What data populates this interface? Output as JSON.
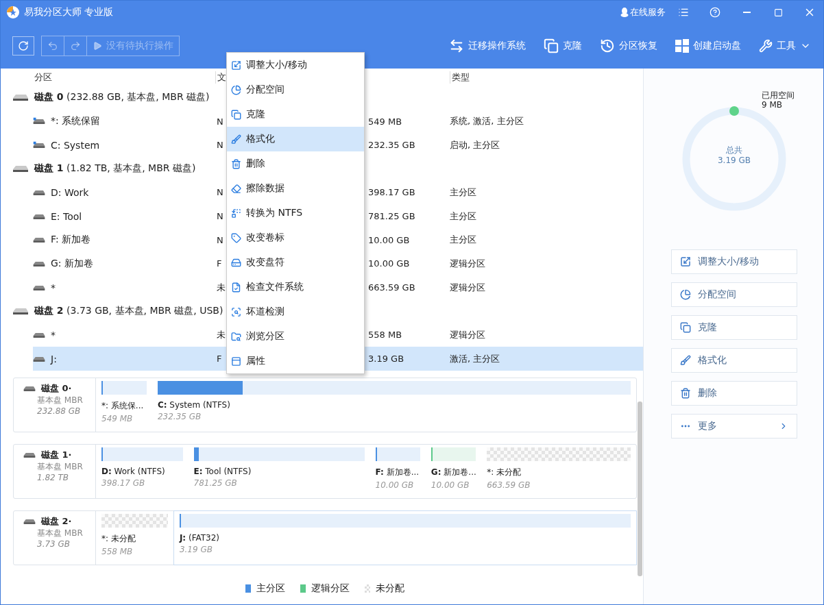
{
  "window": {
    "title": "易我分区大师 专业版",
    "service": "在线服务"
  },
  "toolbar": {
    "pending": "没有待执行操作",
    "actions": [
      {
        "label": "迁移操作系统"
      },
      {
        "label": "克隆"
      },
      {
        "label": "分区恢复"
      },
      {
        "label": "创建启动盘"
      },
      {
        "label": "工具"
      }
    ]
  },
  "table": {
    "columns": [
      "分区",
      "文",
      "类型"
    ],
    "rows": [
      {
        "kind": "disk",
        "name": "**磁盘 0** (232.88 GB, 基本盘, MBR 磁盘)"
      },
      {
        "kind": "system",
        "name": "*: 系统保留",
        "fs": "N",
        "size": "549 MB",
        "type": "系统, 激活, 主分区",
        "selected": false
      },
      {
        "kind": "system",
        "name": "C: System",
        "fs": "N",
        "size": "232.35 GB",
        "type": "启动, 主分区",
        "selected": false
      },
      {
        "kind": "disk",
        "name": "**磁盘 1** (1.82 TB, 基本盘, MBR 磁盘)"
      },
      {
        "kind": "partition",
        "name": "D: Work",
        "fs": "N",
        "size": "398.17 GB",
        "type": "主分区",
        "selected": false
      },
      {
        "kind": "partition",
        "name": "E: Tool",
        "fs": "N",
        "size": "781.25 GB",
        "type": "主分区",
        "selected": false
      },
      {
        "kind": "partition",
        "name": "F: 新加卷",
        "fs": "N",
        "size": "10.00 GB",
        "type": "主分区",
        "selected": false
      },
      {
        "kind": "partition",
        "name": "G: 新加卷",
        "fs": "F",
        "size": "10.00 GB",
        "type": "逻辑分区",
        "selected": false
      },
      {
        "kind": "partition",
        "name": "*",
        "fs": "未",
        "size": "663.59 GB",
        "type": "逻辑分区",
        "selected": false
      },
      {
        "kind": "disk",
        "name": "**磁盘 2** (3.73 GB, 基本盘, MBR 磁盘, USB)"
      },
      {
        "kind": "partition",
        "name": "*",
        "fs": "未",
        "size": "558 MB",
        "type": "逻辑分区",
        "selected": false
      },
      {
        "kind": "partition",
        "name": "J:",
        "fs": "F",
        "size": "3.19 GB",
        "type": "激活, 主分区",
        "selected": true
      }
    ]
  },
  "context_menu": {
    "items": [
      {
        "label": "调整大小/移动",
        "selected": false
      },
      {
        "label": "分配空间",
        "selected": false
      },
      {
        "label": "克隆",
        "selected": false
      },
      {
        "label": "格式化",
        "selected": true
      },
      {
        "label": "删除",
        "selected": false
      },
      {
        "label": "擦除数据",
        "selected": false
      },
      {
        "label": "转换为 NTFS",
        "selected": false
      },
      {
        "label": "改变卷标",
        "selected": false
      },
      {
        "label": "改变盘符",
        "selected": false
      },
      {
        "label": "检查文件系统",
        "selected": false
      },
      {
        "label": "坏道检测",
        "selected": false
      },
      {
        "label": "浏览分区",
        "selected": false
      },
      {
        "label": "属性",
        "selected": false
      }
    ]
  },
  "side_panel": {
    "used_label": "已用空间",
    "used": "9 MB",
    "total_label": "总共",
    "total": "3.19 GB",
    "buttons": [
      {
        "label": "调整大小/移动"
      },
      {
        "label": "分配空间"
      },
      {
        "label": "克隆"
      },
      {
        "label": "格式化"
      },
      {
        "label": "删除"
      },
      {
        "label": "更多"
      }
    ]
  },
  "disk_map": [
    {
      "name": "磁盘 0·",
      "style": "基本盘 MBR",
      "size": "232.88 GB",
      "partitions": [
        {
          "kind": "primary",
          "label": "*: 系统保...",
          "size": "549 MB",
          "level": 0.03,
          "selected": false
        },
        {
          "kind": "primary",
          "label": "**C:** System (NTFS)",
          "size": "232.35 GB",
          "level": 0.18,
          "selected": false
        }
      ]
    },
    {
      "name": "磁盘 1·",
      "style": "基本盘 MBR",
      "size": "1.82 TB",
      "partitions": [
        {
          "kind": "primary",
          "label": "**D:** Work (NTFS)",
          "size": "398.17 GB",
          "level": 0.01,
          "selected": false
        },
        {
          "kind": "primary",
          "label": "**E:** Tool (NTFS)",
          "size": "781.25 GB",
          "level": 0.03,
          "selected": false
        },
        {
          "kind": "primary",
          "label": "**F:** 新加卷...",
          "size": "10.00 GB",
          "level": 0.02,
          "selected": false
        },
        {
          "kind": "logical",
          "label": "**G:** 新加卷...",
          "size": "10.00 GB",
          "level": 0.02,
          "selected": false
        },
        {
          "kind": "unallocated",
          "label": "*: 未分配",
          "size": "663.59 GB",
          "selected": false
        }
      ]
    },
    {
      "name": "磁盘 2·",
      "style": "基本盘 MBR",
      "size": "3.73 GB",
      "partitions": [
        {
          "kind": "unallocated",
          "label": "*: 未分配",
          "size": "558 MB",
          "selected": false
        },
        {
          "kind": "primary",
          "label": "**J:**  (FAT32)",
          "size": "3.19 GB",
          "level": 0.003,
          "selected": true
        }
      ]
    }
  ],
  "legend": [
    {
      "kind": "primary",
      "label": "主分区"
    },
    {
      "kind": "logical",
      "label": "逻辑分区"
    },
    {
      "kind": "unallocated",
      "label": "未分配"
    }
  ]
}
